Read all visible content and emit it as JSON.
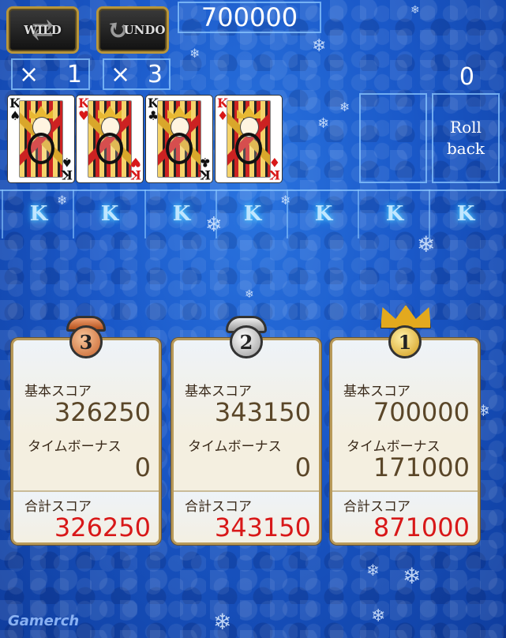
{
  "top": {
    "wild_label": "WILD",
    "undo_label": "UNDO",
    "score": "700000",
    "wild_count": {
      "x": "×",
      "n": "1"
    },
    "undo_count": {
      "x": "×",
      "n": "3"
    },
    "right_counter": "0"
  },
  "cards": [
    {
      "rank": "K",
      "suit": "♠",
      "color": "black"
    },
    {
      "rank": "K",
      "suit": "♥",
      "color": "red"
    },
    {
      "rank": "K",
      "suit": "♣",
      "color": "black"
    },
    {
      "rank": "K",
      "suit": "♦",
      "color": "red"
    }
  ],
  "rollback_label": {
    "line1": "Roll",
    "line2": "back"
  },
  "k_row": [
    "K",
    "K",
    "K",
    "K",
    "K",
    "K",
    "K"
  ],
  "results": [
    {
      "rank": "3",
      "base_label": "基本スコア",
      "base": "326250",
      "bonus_label": "タイムボーナス",
      "bonus": "0",
      "total_label": "合計スコア",
      "total": "326250"
    },
    {
      "rank": "2",
      "base_label": "基本スコア",
      "base": "343150",
      "bonus_label": "タイムボーナス",
      "bonus": "0",
      "total_label": "合計スコア",
      "total": "343150"
    },
    {
      "rank": "1",
      "base_label": "基本スコア",
      "base": "700000",
      "bonus_label": "タイムボーナス",
      "bonus": "171000",
      "total_label": "合計スコア",
      "total": "871000"
    }
  ],
  "watermark": "Gamerch",
  "colors": {
    "background": "#1a58c8",
    "total_red": "#d81818",
    "panel_border": "#b89a5a"
  }
}
